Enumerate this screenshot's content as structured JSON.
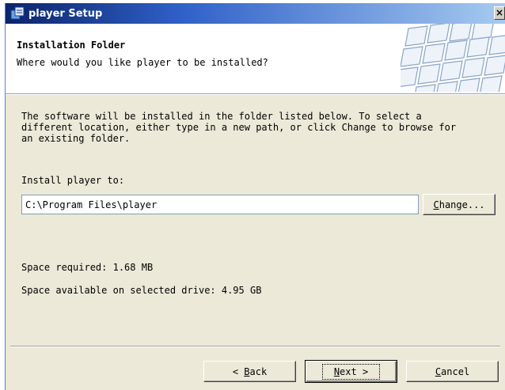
{
  "window": {
    "title": "player Setup",
    "close_glyph": "×"
  },
  "header": {
    "title": "Installation Folder",
    "subtitle": "Where would you like player to be installed?"
  },
  "body": {
    "description_lines": [
      "The software will be installed in the folder listed below. To select a",
      "different location, either type in a new path, or click Change to browse for",
      "an existing folder."
    ],
    "install_label": "Install player to:",
    "install_path": "C:\\Program Files\\player",
    "change_button": {
      "mnemonic": "C",
      "rest": "hange..."
    },
    "space_required": "Space required: 1.68 MB",
    "space_available": "Space available on selected drive: 4.95 GB"
  },
  "footer": {
    "back_button": {
      "prefix": "< ",
      "mnemonic": "B",
      "rest": "ack"
    },
    "next_button": {
      "mnemonic": "N",
      "rest": "ext >"
    },
    "cancel_button": {
      "mnemonic": "C",
      "rest": "ancel"
    }
  },
  "icons": {
    "title_icon": "setup-installer-icon",
    "banner": "keyboard-keys-banner"
  }
}
